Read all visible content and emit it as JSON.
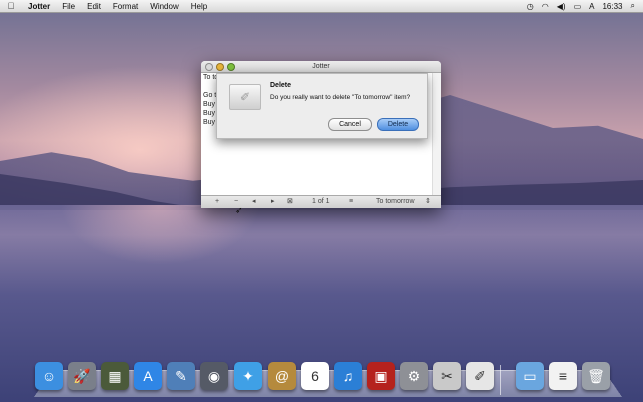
{
  "menubar": {
    "apple_icon": "",
    "app_name": "Jotter",
    "menus": [
      "File",
      "Edit",
      "Format",
      "Window",
      "Help"
    ],
    "status_icons": [
      "time-machine-icon",
      "wifi-icon",
      "volume-icon",
      "battery-icon",
      "input-menu-icon",
      "spotlight-icon"
    ],
    "clock": "16:33"
  },
  "window": {
    "title": "Jotter",
    "notes": [
      "To tomorrow",
      "",
      "Go t",
      "Buy",
      "Buy",
      "Buy"
    ],
    "bottom": {
      "add": "+",
      "remove": "−",
      "prev": "◂",
      "next": "▸",
      "page": "1 of 1",
      "list_icon": "≡",
      "selected": "To tomorrow"
    }
  },
  "dialog": {
    "title": "Delete",
    "message": "Do you really want to delete \"To tomorrow\" item?",
    "cancel_label": "Cancel",
    "delete_label": "Delete"
  },
  "dock": {
    "items": [
      {
        "name": "finder-icon",
        "glyph": "☺",
        "color": "#3c8fe0"
      },
      {
        "name": "launchpad-icon",
        "glyph": "🚀",
        "color": "#7a7f8a"
      },
      {
        "name": "mission-control-icon",
        "glyph": "▦",
        "color": "#4b5a3a"
      },
      {
        "name": "app-store-icon",
        "glyph": "A",
        "color": "#2f86e6"
      },
      {
        "name": "preview-icon",
        "glyph": "✎",
        "color": "#4f7fb8"
      },
      {
        "name": "facetime-icon",
        "glyph": "◉",
        "color": "#555a66"
      },
      {
        "name": "safari-icon",
        "glyph": "✦",
        "color": "#3fa0e6"
      },
      {
        "name": "contacts-icon",
        "glyph": "@",
        "color": "#b58a3d"
      },
      {
        "name": "calendar-icon",
        "glyph": "6",
        "color": "#ffffff"
      },
      {
        "name": "itunes-icon",
        "glyph": "♫",
        "color": "#2b7fd6"
      },
      {
        "name": "photo-booth-icon",
        "glyph": "▣",
        "color": "#b5221d"
      },
      {
        "name": "system-preferences-icon",
        "glyph": "⚙",
        "color": "#8e9096"
      },
      {
        "name": "utility-icon",
        "glyph": "✂",
        "color": "#c9c9c9"
      },
      {
        "name": "jotter-icon",
        "glyph": "✐",
        "color": "#e6e6e6"
      },
      {
        "name": "folder-icon",
        "glyph": "▭",
        "color": "#6aa6df"
      },
      {
        "name": "document-icon",
        "glyph": "≡",
        "color": "#f2f2f2"
      },
      {
        "name": "trash-icon",
        "glyph": "🗑",
        "color": "#9aa0a8"
      }
    ]
  }
}
